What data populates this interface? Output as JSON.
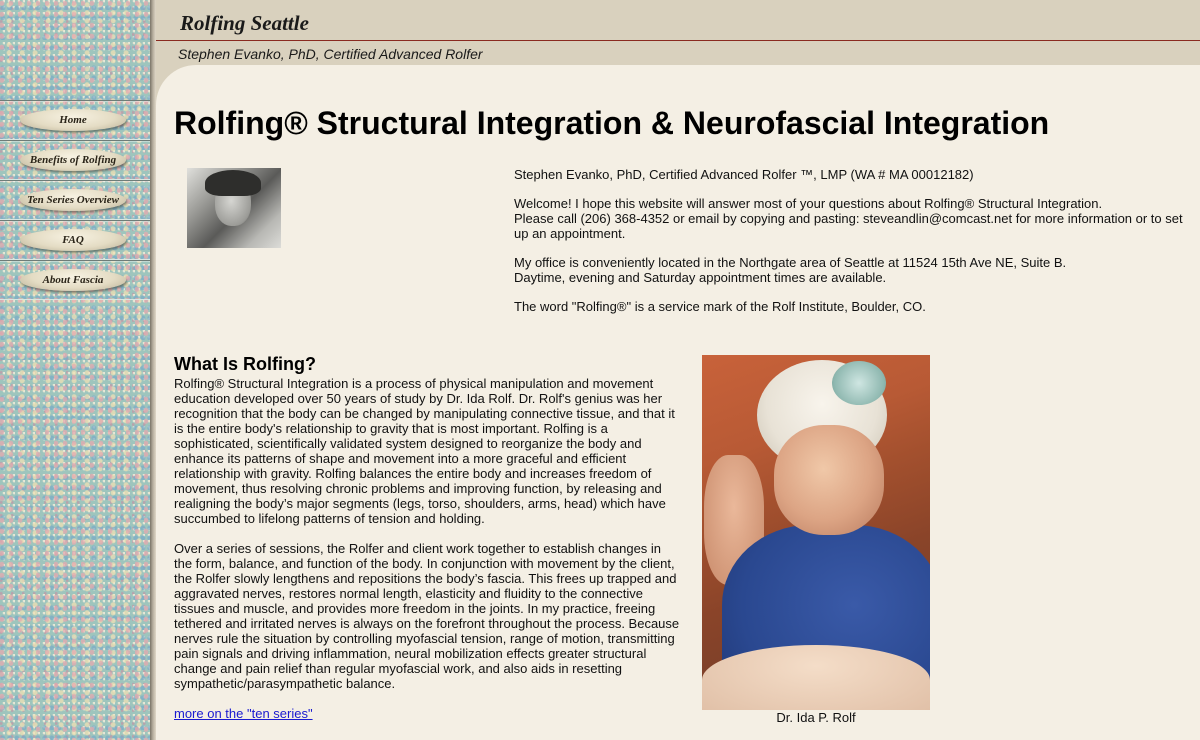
{
  "header": {
    "site_title": "Rolfing Seattle",
    "subtitle": "Stephen Evanko, PhD, Certified Advanced Rolfer"
  },
  "nav": {
    "items": [
      {
        "label": "Home"
      },
      {
        "label": "Benefits of Rolfing"
      },
      {
        "label": "Ten Series Overview"
      },
      {
        "label": "FAQ"
      },
      {
        "label": "About Fascia"
      }
    ]
  },
  "main": {
    "title": "Rolfing® Structural Integration & Neurofascial Integration",
    "intro": {
      "credentials": "Stephen Evanko, PhD, Certified Advanced Rolfer ™, LMP (WA # MA 00012182)",
      "welcome": " Welcome! I hope this website will answer most of your questions about Rolfing® Structural Integration.",
      "contact": "Please call (206) 368-4352 or email by copying and pasting: steveandlin@comcast.net for more information or to set up an appointment.",
      "location": "My office is conveniently located in the Northgate area of Seattle at 11524 15th Ave NE, Suite B.",
      "hours": "Daytime, evening and Saturday appointment times are available.",
      "trademark": "The word \"Rolfing®\" is a service mark of the Rolf Institute, Boulder, CO."
    },
    "what_is": {
      "heading": "What Is Rolfing?",
      "paragraph1": "Rolfing® Structural Integration is a process of physical manipulation and movement education developed over 50 years of study by Dr. Ida Rolf. Dr. Rolf's genius was her recognition that the body can be changed by manipulating connective tissue, and that it is the entire body's relationship to gravity that is most important. Rolfing is a sophisticated, scientifically validated system designed to reorganize the body and enhance its patterns of shape and movement into a more graceful and efficient relationship with gravity. Rolfing balances the entire body and increases freedom of movement, thus resolving chronic problems and improving function, by releasing and realigning the body’s major segments (legs, torso, shoulders, arms, head) which have succumbed to lifelong patterns of tension and holding.",
      "paragraph2": "Over a series of sessions, the Rolfer and client work together to establish changes in the form, balance, and function of the body. In conjunction with movement by the client, the Rolfer slowly lengthens and repositions the body’s fascia. This frees up trapped and aggravated nerves, restores normal length, elasticity and fluidity to the connective tissues and muscle, and provides more freedom in the joints. In my practice, freeing tethered and irritated nerves is always on the forefront throughout the process. Because nerves rule the situation by controlling myofascial tension, range of motion, transmitting pain signals and driving inflammation, neural mobilization effects greater structural change and pain relief than regular myofascial work, and also aids in resetting sympathetic/parasympathetic balance.",
      "more_link": "more on the \"ten series\""
    },
    "photo_caption": "Dr. Ida P. Rolf"
  }
}
